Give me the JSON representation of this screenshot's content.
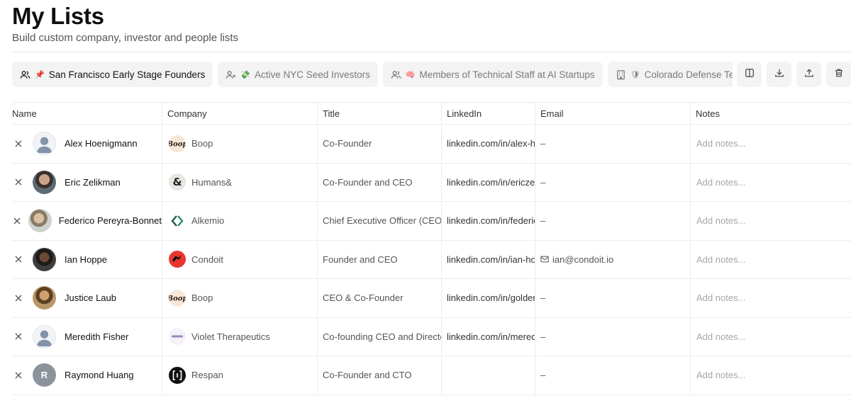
{
  "header": {
    "title": "My Lists",
    "subtitle": "Build custom company, investor and people lists"
  },
  "tabs": [
    {
      "icon": "users-icon",
      "emoji": "📌",
      "label": "San Francisco Early Stage Founders",
      "active": true
    },
    {
      "icon": "user-plus-icon",
      "emoji": "💸",
      "label": "Active NYC Seed Investors",
      "active": false
    },
    {
      "icon": "users-icon",
      "emoji": "🧠",
      "label": "Members of Technical Staff at AI Startups",
      "active": false
    },
    {
      "icon": "building-icon",
      "emoji": "🛡",
      "label": "Colorado Defense Tech Startups",
      "active": false
    }
  ],
  "toolbar": [
    "columns-icon",
    "download-icon",
    "upload-icon",
    "trash-icon"
  ],
  "columns": {
    "name": "Name",
    "company": "Company",
    "title": "Title",
    "linkedin": "LinkedIn",
    "email": "Email",
    "notes": "Notes"
  },
  "rows": [
    {
      "name": "Alex Hoenigmann",
      "avatar": "placeholder",
      "company": "Boop",
      "logo": "boop",
      "title": "Co-Founder",
      "linkedin": "linkedin.com/in/alex-hoenigmann",
      "email": "–",
      "notes": "Add notes..."
    },
    {
      "name": "Eric Zelikman",
      "avatar": "photo",
      "company": "Humans&",
      "logo": "humans",
      "title": "Co-Founder and CEO",
      "linkedin": "linkedin.com/in/ericzelikman",
      "email": "–",
      "notes": "Add notes..."
    },
    {
      "name": "Federico Pereyra-Bonnet",
      "avatar": "photo",
      "company": "Alkemio",
      "logo": "alkemio",
      "title": "Chief Executive Officer (CEO)",
      "linkedin": "linkedin.com/in/federico",
      "email": "–",
      "notes": "Add notes..."
    },
    {
      "name": "Ian Hoppe",
      "avatar": "photo",
      "company": "Condoit",
      "logo": "condoit",
      "title": "Founder and CEO",
      "linkedin": "linkedin.com/in/ian-hoppe",
      "email": "ian@condoit.io",
      "notes": "Add notes..."
    },
    {
      "name": "Justice Laub",
      "avatar": "photo",
      "company": "Boop",
      "logo": "boop",
      "title": "CEO & Co-Founder",
      "linkedin": "linkedin.com/in/goldenlaub",
      "email": "–",
      "notes": "Add notes..."
    },
    {
      "name": "Meredith Fisher",
      "avatar": "placeholder",
      "company": "Violet Therapeutics",
      "logo": "violet",
      "title": "Co-founding CEO and Director",
      "linkedin": "linkedin.com/in/meredith",
      "email": "–",
      "notes": "Add notes..."
    },
    {
      "name": "Raymond Huang",
      "avatar": "initial",
      "initial": "R",
      "company": "Respan",
      "logo": "respan",
      "title": "Co-Founder and CTO",
      "linkedin": "",
      "email": "–",
      "notes": "Add notes..."
    }
  ],
  "colors": {
    "tab_bg": "#f3f3f4",
    "border": "#ececec",
    "muted_text": "#555555",
    "placeholder_text": "#a6a6a6"
  }
}
